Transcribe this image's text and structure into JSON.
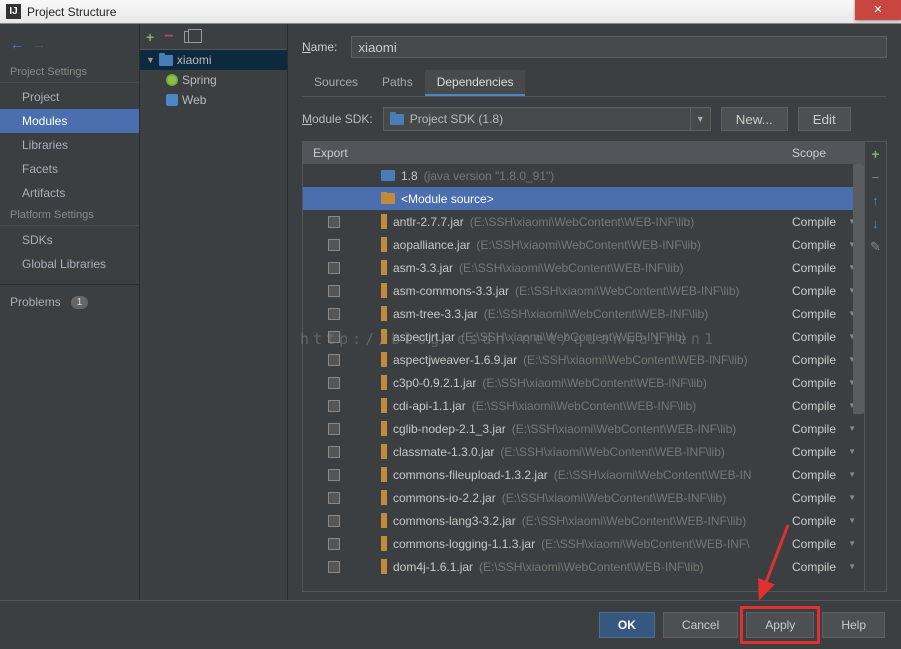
{
  "window": {
    "title": "Project Structure"
  },
  "sidebar": {
    "section1": "Project Settings",
    "items1": [
      "Project",
      "Modules",
      "Libraries",
      "Facets",
      "Artifacts"
    ],
    "section2": "Platform Settings",
    "items2": [
      "SDKs",
      "Global Libraries"
    ],
    "problems_label": "Problems",
    "problems_count": "1"
  },
  "tree": {
    "root": "xiaomi",
    "children": [
      "Spring",
      "Web"
    ]
  },
  "content": {
    "name_label_pre": "N",
    "name_label_post": "ame:",
    "name_value": "xiaomi",
    "tabs": [
      "Sources",
      "Paths",
      "Dependencies"
    ],
    "sdk_label_pre": "M",
    "sdk_label_post": "odule SDK:",
    "sdk_value": "Project SDK (1.8)",
    "btn_new": "New...",
    "btn_edit": "Edit",
    "col_export": "Export",
    "col_scope": "Scope",
    "sdk_row": {
      "name": "1.8",
      "hint": "(java version \"1.8.0_91\")"
    },
    "module_src": "<Module source>",
    "jars": [
      {
        "name": "antlr-2.7.7.jar",
        "path": "(E:\\SSH\\xiaomi\\WebContent\\WEB-INF\\lib)",
        "scope": "Compile"
      },
      {
        "name": "aopalliance.jar",
        "path": "(E:\\SSH\\xiaomi\\WebContent\\WEB-INF\\lib)",
        "scope": "Compile"
      },
      {
        "name": "asm-3.3.jar",
        "path": "(E:\\SSH\\xiaomi\\WebContent\\WEB-INF\\lib)",
        "scope": "Compile"
      },
      {
        "name": "asm-commons-3.3.jar",
        "path": "(E:\\SSH\\xiaomi\\WebContent\\WEB-INF\\lib)",
        "scope": "Compile"
      },
      {
        "name": "asm-tree-3.3.jar",
        "path": "(E:\\SSH\\xiaomi\\WebContent\\WEB-INF\\lib)",
        "scope": "Compile"
      },
      {
        "name": "aspectjrt.jar",
        "path": "(E:\\SSH\\xiaomi\\WebContent\\WEB-INF\\lib)",
        "scope": "Compile"
      },
      {
        "name": "aspectjweaver-1.6.9.jar",
        "path": "(E:\\SSH\\xiaomi\\WebContent\\WEB-INF\\lib)",
        "scope": "Compile"
      },
      {
        "name": "c3p0-0.9.2.1.jar",
        "path": "(E:\\SSH\\xiaomi\\WebContent\\WEB-INF\\lib)",
        "scope": "Compile"
      },
      {
        "name": "cdi-api-1.1.jar",
        "path": "(E:\\SSH\\xiaomi\\WebContent\\WEB-INF\\lib)",
        "scope": "Compile"
      },
      {
        "name": "cglib-nodep-2.1_3.jar",
        "path": "(E:\\SSH\\xiaomi\\WebContent\\WEB-INF\\lib)",
        "scope": "Compile"
      },
      {
        "name": "classmate-1.3.0.jar",
        "path": "(E:\\SSH\\xiaomi\\WebContent\\WEB-INF\\lib)",
        "scope": "Compile"
      },
      {
        "name": "commons-fileupload-1.3.2.jar",
        "path": "(E:\\SSH\\xiaomi\\WebContent\\WEB-IN",
        "scope": "Compile"
      },
      {
        "name": "commons-io-2.2.jar",
        "path": "(E:\\SSH\\xiaomi\\WebContent\\WEB-INF\\lib)",
        "scope": "Compile"
      },
      {
        "name": "commons-lang3-3.2.jar",
        "path": "(E:\\SSH\\xiaomi\\WebContent\\WEB-INF\\lib)",
        "scope": "Compile"
      },
      {
        "name": "commons-logging-1.1.3.jar",
        "path": "(E:\\SSH\\xiaomi\\WebContent\\WEB-INF\\",
        "scope": "Compile"
      },
      {
        "name": "dom4j-1.6.1.jar",
        "path": "(E:\\SSH\\xiaomi\\WebContent\\WEB-INF\\lib)",
        "scope": "Compile"
      }
    ]
  },
  "footer": {
    "ok": "OK",
    "cancel": "Cancel",
    "apply": "Apply",
    "help": "Help"
  },
  "watermark": "http://blog.csdn.net/quanwairen1"
}
